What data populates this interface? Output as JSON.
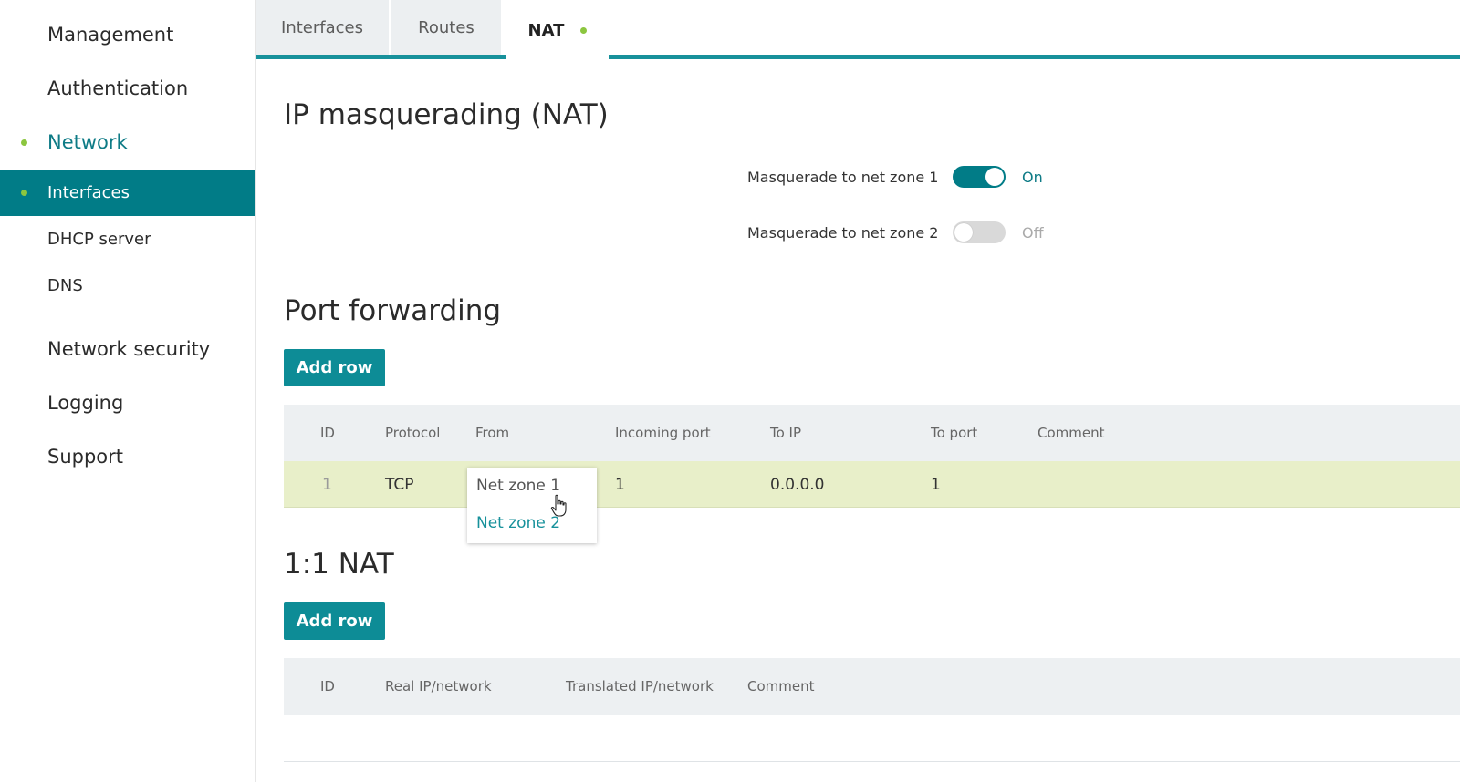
{
  "sidebar": {
    "items": [
      {
        "label": "Management"
      },
      {
        "label": "Authentication"
      },
      {
        "label": "Network"
      },
      {
        "label": "Interfaces"
      },
      {
        "label": "DHCP server"
      },
      {
        "label": "DNS"
      },
      {
        "label": "Network security"
      },
      {
        "label": "Logging"
      },
      {
        "label": "Support"
      }
    ],
    "active_section": "Network",
    "active_item": "Interfaces"
  },
  "tabs": [
    {
      "label": "Interfaces"
    },
    {
      "label": "Routes"
    },
    {
      "label": "NAT",
      "active": true
    }
  ],
  "masquerading": {
    "title": "IP masquerading (NAT)",
    "zone1": {
      "label": "Masquerade to net zone 1",
      "on": true,
      "state": "On"
    },
    "zone2": {
      "label": "Masquerade to net zone 2",
      "on": false,
      "state": "Off"
    }
  },
  "port_forwarding": {
    "title": "Port forwarding",
    "add_row_label": "Add row",
    "columns": [
      "ID",
      "Protocol",
      "From",
      "Incoming port",
      "To IP",
      "To port",
      "Comment"
    ],
    "rows": [
      {
        "id": "1",
        "protocol": "TCP",
        "from": "Net zone 1",
        "incoming_port": "1",
        "to_ip": "0.0.0.0",
        "to_port": "1",
        "comment": ""
      }
    ],
    "from_dropdown": {
      "current": "Net zone 1",
      "options": [
        "Net zone 2"
      ]
    }
  },
  "one_to_one_nat": {
    "title": "1:1 NAT",
    "add_row_label": "Add row",
    "columns": [
      "ID",
      "Real IP/network",
      "Translated IP/network",
      "Comment"
    ]
  },
  "colors": {
    "accent": "#017c87",
    "tab_underline": "#17919b",
    "button": "#0d8c96",
    "status_dot": "#8cc63f",
    "row_highlight": "#e8efc9"
  }
}
